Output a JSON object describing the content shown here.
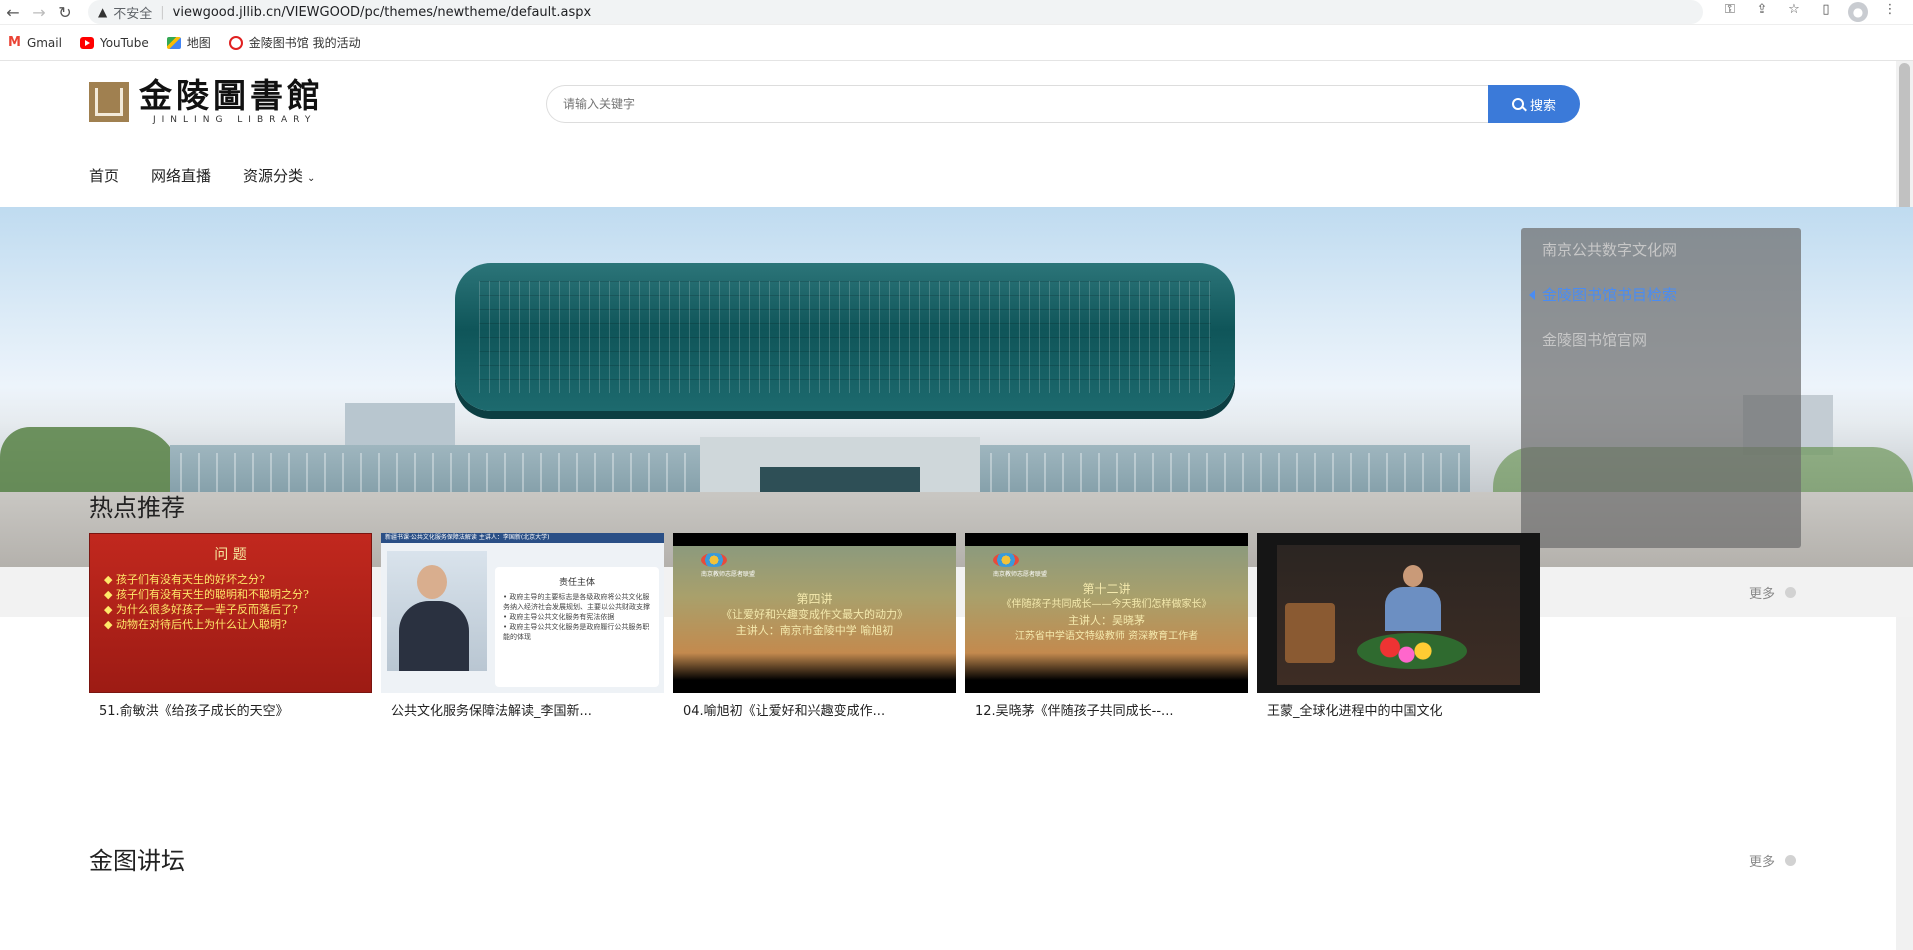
{
  "browser": {
    "insecure_label": "不安全",
    "url": "viewgood.jllib.cn/VIEWGOOD/pc/themes/newtheme/default.aspx",
    "bookmarks": [
      {
        "label": "Gmail",
        "icon": "gmail-icon"
      },
      {
        "label": "YouTube",
        "icon": "youtube-icon"
      },
      {
        "label": "地图",
        "icon": "maps-icon"
      },
      {
        "label": "金陵图书馆 我的活动",
        "icon": "jinling-icon"
      }
    ]
  },
  "header": {
    "logo_cn": "金陵圖書館",
    "logo_en": "JINLING LIBRARY",
    "search_placeholder": "请输入关键字",
    "search_button": "搜索"
  },
  "menu": {
    "home": "首页",
    "live": "网络直播",
    "categories": "资源分类"
  },
  "side_panel": {
    "links": [
      "南京公共数字文化网",
      "金陵图书馆书目检索",
      "金陵图书馆官网"
    ],
    "active_index": 1
  },
  "notice": {
    "more": "更多"
  },
  "hot": {
    "title": "热点推荐",
    "videos": [
      {
        "caption": "51.俞敏洪《给孩子成长的天空》",
        "thumb_title": "问 题",
        "thumb_lines": [
          "◆ 孩子们有没有天生的好坏之分?",
          "◆ 孩子们有没有天生的聪明和不聪明之分?",
          "◆ 为什么很多好孩子一辈子反而落后了?",
          "◆ 动物在对待后代上为什么让人聪明?"
        ]
      },
      {
        "caption": "公共文化服务保障法解读_李国新...",
        "thumb_bar": "新疆书课·公共文化服务保障法解读  主讲人：李国新(北京大学)",
        "thumb_title": "责任主体",
        "thumb_lines": [
          "• 政府主导的主要标志是各级政府将公共文化服务纳入经济社会发展规划、主要以公共财政支撑",
          "• 政府主导公共文化服务有宪法依据",
          "• 政府主导公共文化服务是政府履行公共服务职能的体现"
        ]
      },
      {
        "caption": "04.喻旭初《让爱好和兴趣变成作...",
        "thumb_small": "南京教师志愿者联盟",
        "thumb_line1": "第四讲",
        "thumb_line2": "《让爱好和兴趣变成作文最大的动力》",
        "thumb_line3": "主讲人：南京市金陵中学 喻旭初"
      },
      {
        "caption": "12.吴晓茅《伴随孩子共同成长--...",
        "thumb_small": "南京教师志愿者联盟",
        "thumb_line1": "第十二讲",
        "thumb_line2": "《伴随孩子共同成长——今天我们怎样做家长》",
        "thumb_line3": "主讲人：吴晓茅",
        "thumb_line4": "江苏省中学语文特级教师  资深教育工作者"
      },
      {
        "caption": "王蒙_全球化进程中的中国文化"
      }
    ]
  },
  "forum": {
    "title": "金图讲坛",
    "more": "更多"
  },
  "colors": {
    "accent": "#3b7ad9",
    "active_link": "#4a8cf2",
    "notice_icon": "#e88a6a"
  }
}
